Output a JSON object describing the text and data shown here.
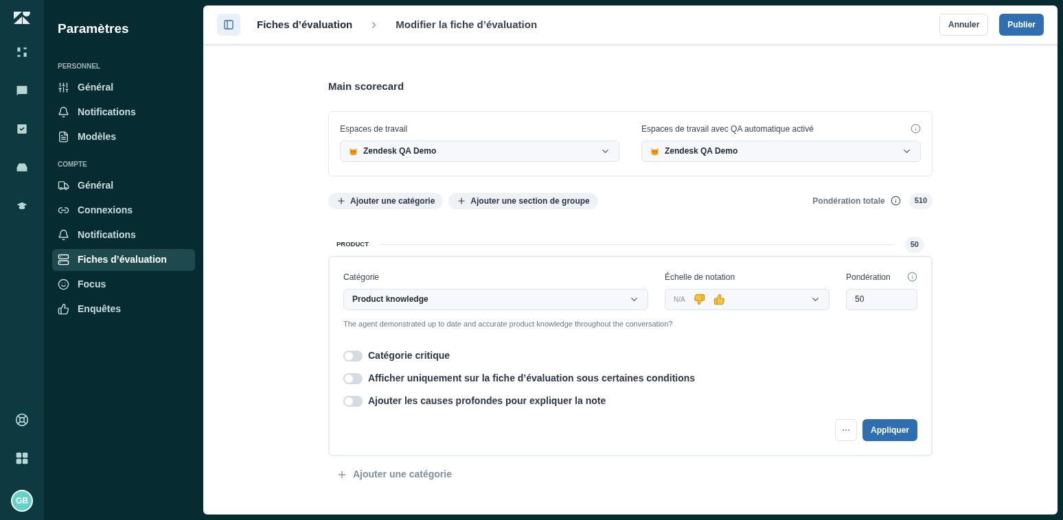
{
  "rail": {
    "avatar": "GB"
  },
  "sidebar": {
    "title": "Paramètres",
    "sections": [
      {
        "heading": "PERSONNEL",
        "items": [
          {
            "label": "Général",
            "selected": false
          },
          {
            "label": "Notifications",
            "selected": false
          },
          {
            "label": "Modèles",
            "selected": false
          }
        ]
      },
      {
        "heading": "COMPTE",
        "items": [
          {
            "label": "Général",
            "selected": false
          },
          {
            "label": "Connexions",
            "selected": false
          },
          {
            "label": "Notifications",
            "selected": false
          },
          {
            "label": "Fiches d’évaluation",
            "selected": true
          },
          {
            "label": "Focus",
            "selected": false
          },
          {
            "label": "Enquêtes",
            "selected": false
          }
        ]
      }
    ]
  },
  "header": {
    "breadcrumb": [
      "Fiches d’évaluation",
      "Modifier la fiche d’évaluation"
    ],
    "cancel": "Annuler",
    "publish": "Publier"
  },
  "scorecard": {
    "title": "Main scorecard",
    "workspaces": [
      {
        "label": "Espaces de travail",
        "value": "Zendesk QA Demo"
      },
      {
        "label": "Espaces de travail avec QA automatique activé",
        "value": "Zendesk QA Demo"
      }
    ],
    "actions": [
      "Ajouter une catégorie",
      "Ajouter une section de groupe"
    ],
    "total_label": "Pondération totale",
    "total": "510",
    "group": {
      "name": "PRODUCT",
      "weight": "50",
      "category": {
        "label": "Catégorie",
        "value": "Product knowledge",
        "scale_label": "Échelle de notation",
        "scale_na": "N/A",
        "weight_label": "Pondération",
        "weight": "50",
        "description": "The agent demonstrated up to date and accurate product knowledge throughout the conversation?",
        "toggles": [
          {
            "label": "Catégorie critique",
            "on": false
          },
          {
            "label": "Afficher uniquement sur la fiche d’évaluation sous certaines conditions",
            "on": false
          },
          {
            "label": "Ajouter les causes profondes pour expliquer la note",
            "on": false
          }
        ],
        "apply": "Appliquer"
      },
      "add_category": "Ajouter une catégorie"
    }
  }
}
